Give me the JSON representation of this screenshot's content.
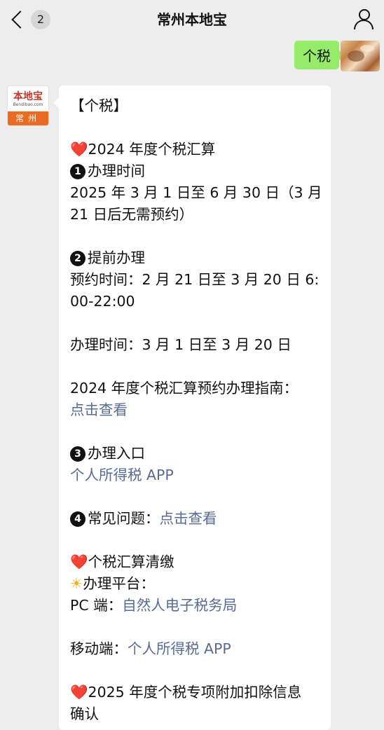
{
  "nav": {
    "badge": "2",
    "title": "常州本地宝"
  },
  "sent_message": "个税",
  "logo": {
    "top": "本地宝",
    "mid": "Bendibao.com",
    "bottom": "常州"
  },
  "message": {
    "l01": "【个税】",
    "heart": "❤️",
    "l03": "2024 年度个税汇算",
    "n1": "❶",
    "l04": "办理时间",
    "l05": "2025 年 3 月 1 日至 6 月 30 日（3 月",
    "l06": "21 日后无需预约）",
    "n2": "❷",
    "l08": "提前办理",
    "l09": "预约时间：2 月 21 日至 3 月 20 日 6:",
    "l10": "00-22:00",
    "l12": "办理时间：3 月 1 日至 3 月 20 日",
    "l14": "2024 年度个税汇算预约办理指南：",
    "l15": "点击查看",
    "n3": "❸",
    "l17": "办理入口",
    "l18": "个人所得税 APP",
    "n4": "❹",
    "l20a": "常见问题：",
    "l20b": "点击查看",
    "l22": "个税汇算清缴",
    "sun": "☀",
    "l23": "办理平台：",
    "l24a": "PC 端：",
    "l24b": "自然人电子税务局",
    "l26a": "移动端：",
    "l26b": "个人所得税 APP",
    "l28": "2025 年度个税专项附加扣除信息",
    "l29": "确认"
  }
}
